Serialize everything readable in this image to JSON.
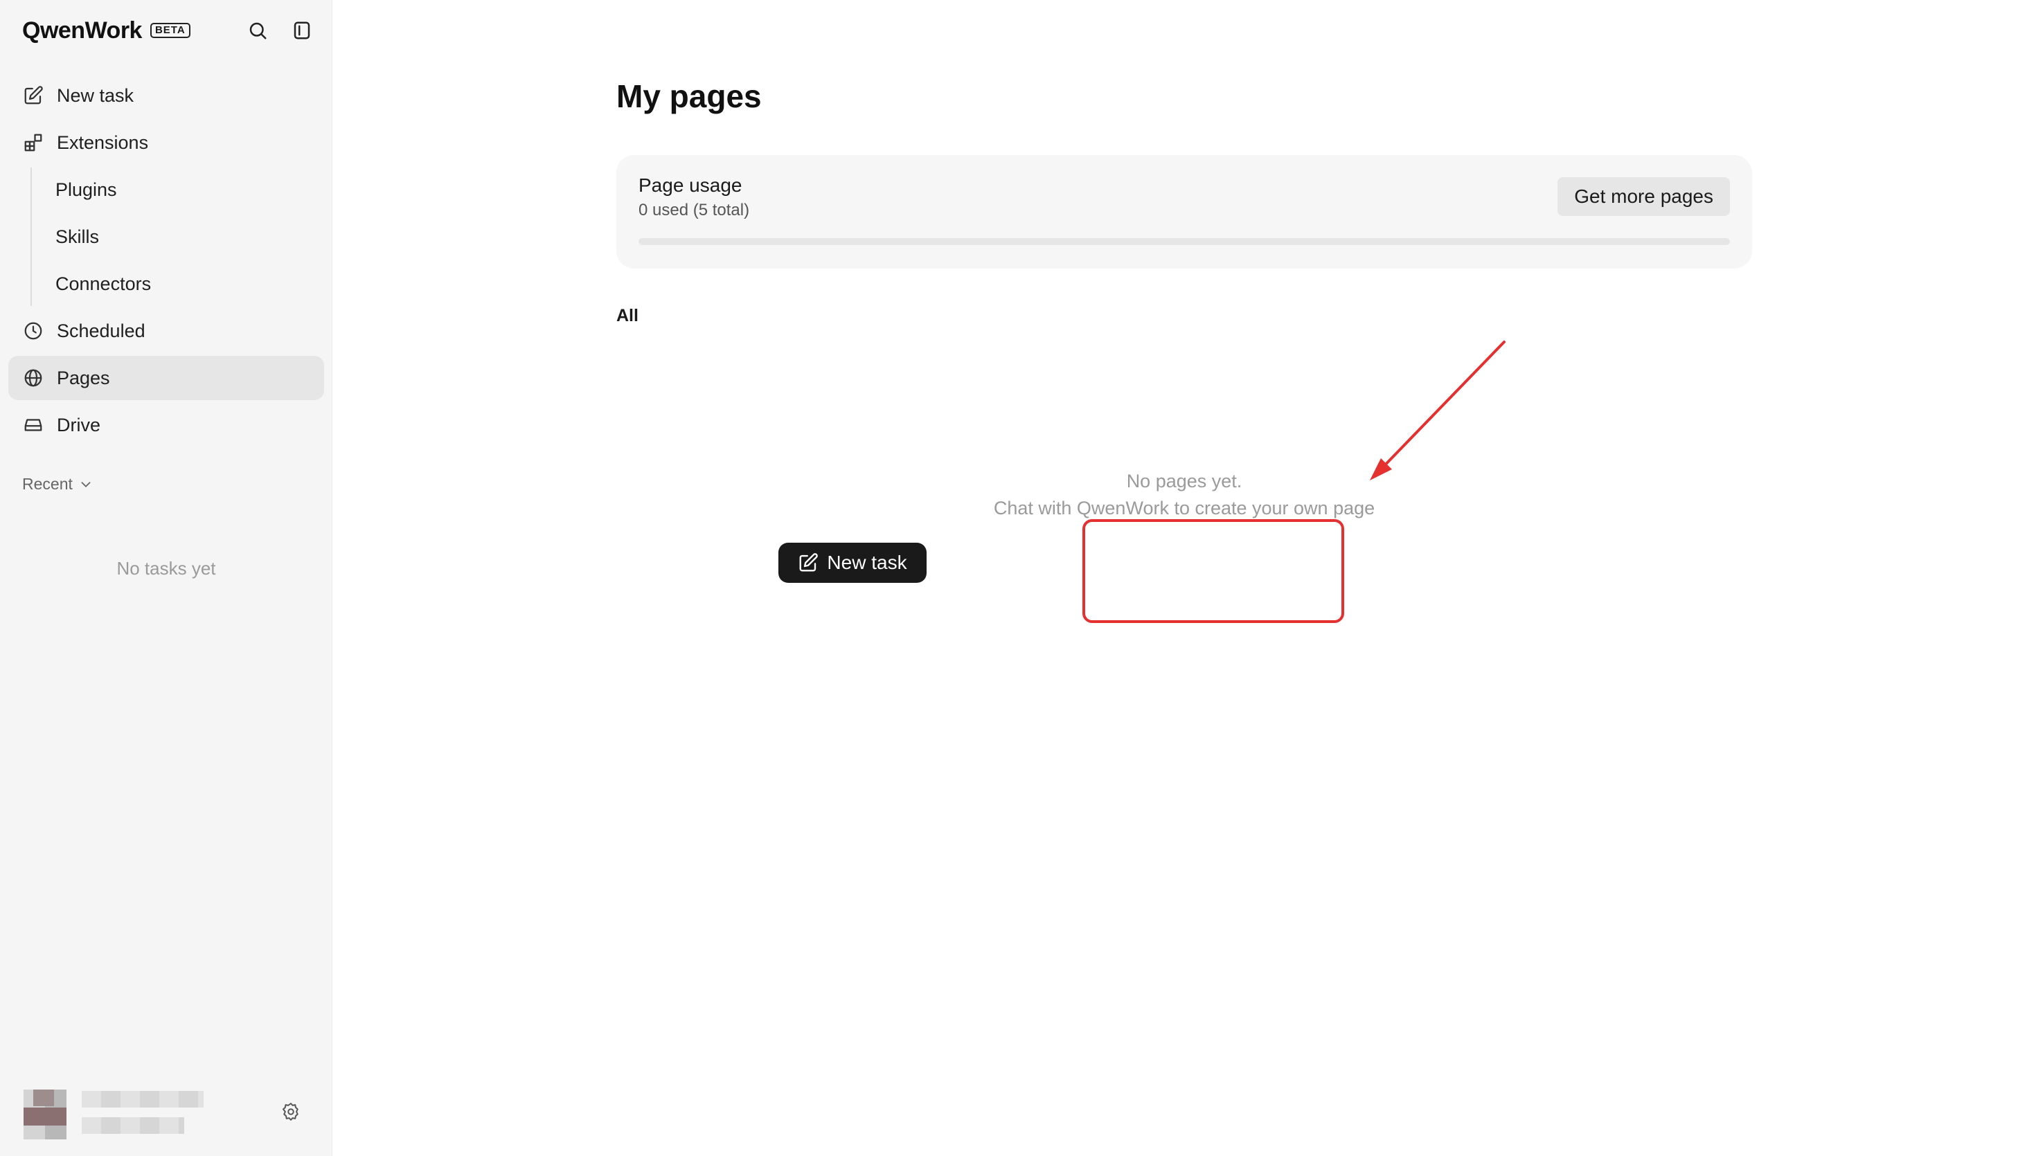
{
  "app": {
    "name": "QwenWork",
    "badge": "BETA"
  },
  "sidebar": {
    "items": [
      {
        "label": "New task",
        "icon": "edit-icon"
      },
      {
        "label": "Extensions",
        "icon": "extensions-icon"
      }
    ],
    "extensions_children": [
      {
        "label": "Plugins"
      },
      {
        "label": "Skills"
      },
      {
        "label": "Connectors"
      }
    ],
    "bottom_items": [
      {
        "label": "Scheduled",
        "icon": "clock-icon"
      },
      {
        "label": "Pages",
        "icon": "globe-icon",
        "active": true
      },
      {
        "label": "Drive",
        "icon": "drive-icon"
      }
    ],
    "recent_label": "Recent",
    "no_tasks": "No tasks yet"
  },
  "main": {
    "title": "My pages",
    "usage": {
      "title": "Page usage",
      "subtitle": "0 used (5 total)",
      "used": 0,
      "total": 5,
      "button": "Get more pages"
    },
    "filter_tab": "All",
    "empty": {
      "line1": "No pages yet.",
      "line2": "Chat with QwenWork to create your own page",
      "button": "New task"
    }
  },
  "colors": {
    "sidebar_bg": "#f5f5f5",
    "active_item": "#e6e6e6",
    "primary_button": "#1a1a1a",
    "annotation": "#e53030"
  }
}
